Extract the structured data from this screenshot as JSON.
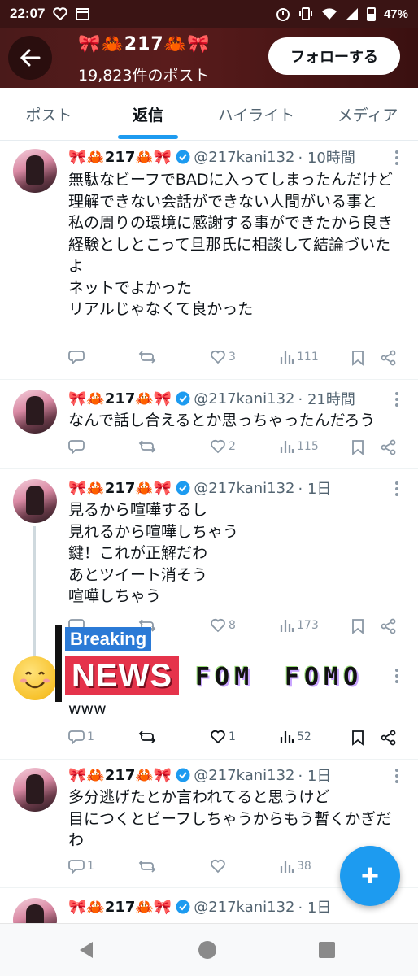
{
  "status_bar": {
    "time": "22:07",
    "battery": "47%",
    "icons": [
      "heart-check-icon",
      "calendar-icon",
      "alarm-icon",
      "vibrate-icon",
      "wifi-icon",
      "signal-icon",
      "battery-icon"
    ]
  },
  "header": {
    "name": "🎀🦀217🦀🎀",
    "post_count": "19,823件のポスト",
    "follow_label": "フォローする"
  },
  "tabs": [
    {
      "label": "ポスト",
      "active": false
    },
    {
      "label": "返信",
      "active": true
    },
    {
      "label": "ハイライト",
      "active": false
    },
    {
      "label": "メディア",
      "active": false
    }
  ],
  "tweets": [
    {
      "name": "🎀🦀217🦀🎀",
      "handle": "@217kani132",
      "time": "· 10時間",
      "text": "無駄なビーフでBADに入ってしまったんだけど\n理解できない会話ができない人間がいる事と\n私の周りの環境に感謝する事ができたから良き経験としとこって旦那氏に相談して結論づいたよ\nネットでよかった\nリアルじゃなくて良かった",
      "replies": "",
      "retweets": "",
      "likes": "3",
      "views": "111"
    },
    {
      "name": "🎀🦀217🦀🎀",
      "handle": "@217kani132",
      "time": "· 21時間",
      "text": "なんで話し合えるとか思っちゃったんだろう",
      "replies": "",
      "retweets": "",
      "likes": "2",
      "views": "115"
    },
    {
      "name": "🎀🦀217🦀🎀",
      "handle": "@217kani132",
      "time": "· 1日",
      "text": "見るから喧嘩するし\n見れるから喧嘩しちゃう\n鍵！これが正解だわ\nあとツイート消そう\n喧嘩しちゃう",
      "replies": "",
      "retweets": "",
      "likes": "8",
      "views": "173"
    },
    {
      "name": "",
      "handle": "",
      "time": "",
      "text": "www",
      "replies": "1",
      "retweets": "",
      "likes": "1",
      "views": "52"
    },
    {
      "name": "🎀🦀217🦀🎀",
      "handle": "@217kani132",
      "time": "· 1日",
      "text": "多分逃げたとか言われてると思うけど\n目につくとビーフしちゃうからもう暫くかぎだわ",
      "replies": "1",
      "retweets": "",
      "likes": "",
      "views": "38"
    },
    {
      "name": "🎀🦀217🦀🎀",
      "handle": "@217kani132",
      "time": "· 1日",
      "text": "",
      "replies": "",
      "retweets": "",
      "likes": "",
      "views": ""
    }
  ],
  "overlay_sticker": {
    "emoji": "😊",
    "breaking": "Breaking",
    "news": "NEWS",
    "fomo_1": "FOM",
    "fomo_2": "FOMO"
  },
  "fab_label": "+",
  "colors": {
    "accent": "#1d9bf0",
    "header_bg": "#4a1a1a",
    "text_primary": "#0f1419",
    "text_secondary": "#536471"
  }
}
